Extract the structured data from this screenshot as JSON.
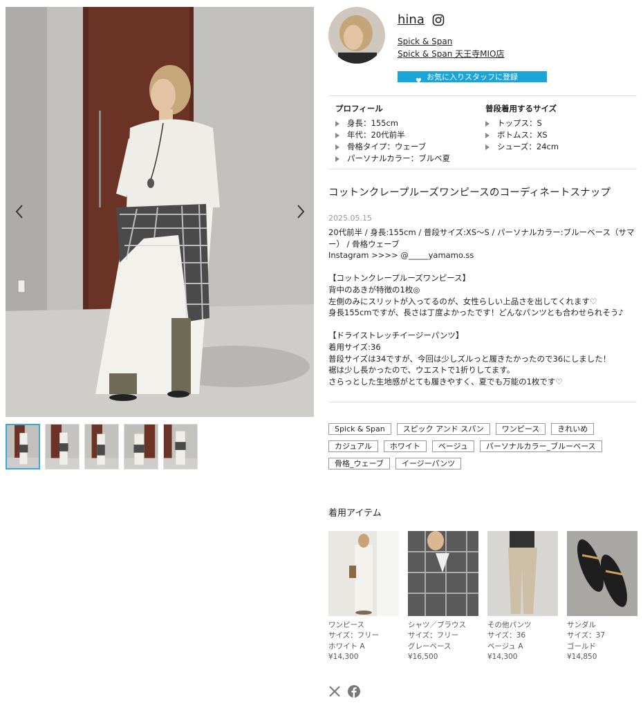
{
  "gallery": {
    "prev_label": "previous photo",
    "next_label": "next photo",
    "thumb_count": 5,
    "active_thumb": 1
  },
  "staff": {
    "name": "hina",
    "brand": "Spick & Span",
    "store": "Spick & Span 天王寺MIO店",
    "favorite_button": "お気に入りスタッフに登録"
  },
  "profile": {
    "heading": "プロフィール",
    "items": [
      "身長：155cm",
      "年代：20代前半",
      "骨格タイプ：ウェーブ",
      "パーソナルカラー：ブルベ夏"
    ]
  },
  "sizes": {
    "heading": "普段着用するサイズ",
    "items": [
      "トップス：S",
      "ボトムス：XS",
      "シューズ：24cm"
    ]
  },
  "article": {
    "title": "コットンクレープルーズワンピースのコーディネートスナップ",
    "date": "2025.05.15",
    "lines": [
      "20代前半 / 身長:155cm / 普段サイズ:XS〜S / パーソナルカラー:ブルーベース（サマ",
      "ー） / 骨格ウェーブ",
      "Instagram >>>> @_____yamamo.ss",
      "",
      "【コットンクレープルーズワンピース】",
      "背中のあきが特徴の1枚◎",
      "左側のみにスリットが入ってるのが、女性らしい上品さを出してくれます♡",
      "身長155cmですが、長さは丁度よかったです！どんなパンツとも合わせられそう♪",
      "",
      "【ドライストレッチイージーパンツ】",
      "着用サイズ:36",
      "普段サイズは34ですが、今回は少しズルっと履きたかったので36にしました！",
      "裾は少し長かったので、ウエストで1折りしてます。",
      "さらっとした生地感がとても履きやすく、夏でも万能の1枚です♡"
    ]
  },
  "tags": [
    "Spick & Span",
    "スピック アンド スパン",
    "ワンピース",
    "きれいめ",
    "カジュアル",
    "ホワイト",
    "ベージュ",
    "パーソナルカラー_ブルーベース",
    "骨格_ウェーブ",
    "イージーパンツ"
  ],
  "items_heading": "着用アイテム",
  "items": [
    {
      "category": "ワンピース",
      "size": "サイズ：フリー",
      "color": "ホワイト A",
      "price": "¥14,300"
    },
    {
      "category": "シャツ／ブラウス",
      "size": "サイズ：フリー",
      "color": "グレーベース",
      "price": "¥16,500"
    },
    {
      "category": "その他パンツ",
      "size": "サイズ：36",
      "color": "ベージュ A",
      "price": "¥14,300"
    },
    {
      "category": "サンダル",
      "size": "サイズ：37",
      "color": "ゴールド",
      "price": "¥14,850"
    }
  ],
  "share": {
    "icons": [
      "x-icon",
      "facebook-icon"
    ]
  },
  "colors": {
    "accent": "#1aa4d8",
    "active_thumb_border": "#3aa7de"
  }
}
